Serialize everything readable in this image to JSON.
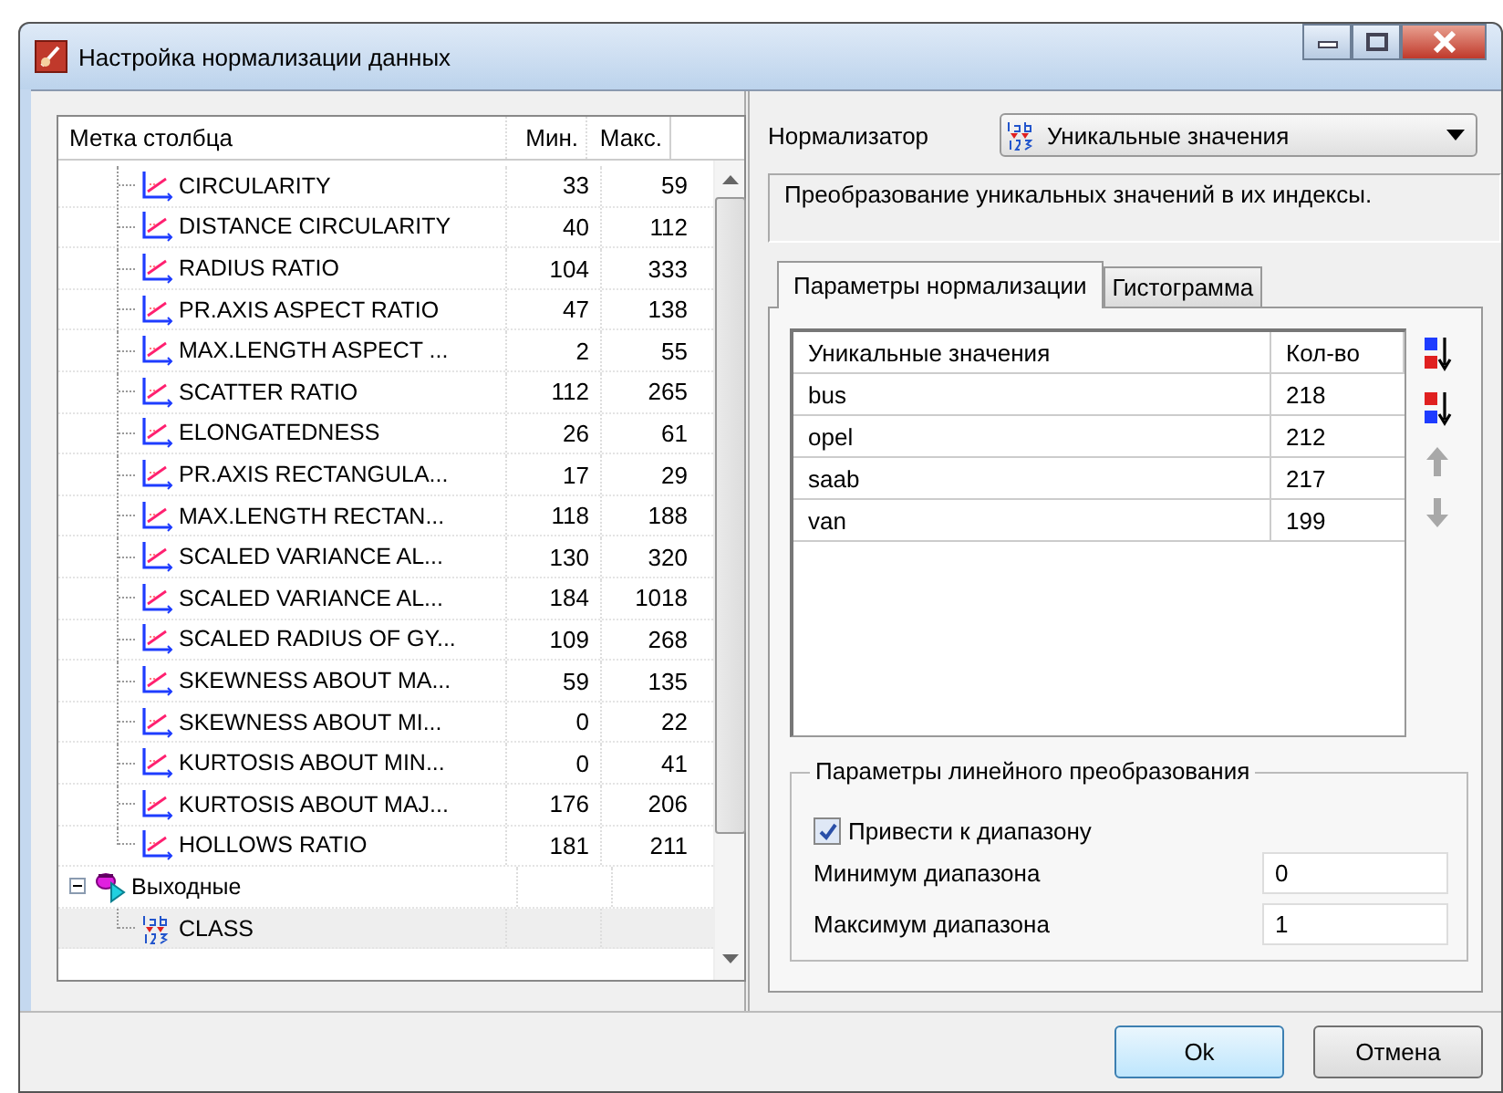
{
  "window": {
    "title": "Настройка нормализации данных"
  },
  "tree": {
    "columns": [
      "Метка столбца",
      "Мин.",
      "Макс."
    ],
    "fields": [
      {
        "label": "CIRCULARITY",
        "min": "33",
        "max": "59",
        "kind": "numeric",
        "selected": false
      },
      {
        "label": "DISTANCE CIRCULARITY",
        "min": "40",
        "max": "112",
        "kind": "numeric",
        "selected": false
      },
      {
        "label": "RADIUS RATIO",
        "min": "104",
        "max": "333",
        "kind": "numeric",
        "selected": false
      },
      {
        "label": "PR.AXIS ASPECT RATIO",
        "min": "47",
        "max": "138",
        "kind": "numeric",
        "selected": false
      },
      {
        "label": "MAX.LENGTH ASPECT ...",
        "min": "2",
        "max": "55",
        "kind": "numeric",
        "selected": false
      },
      {
        "label": "SCATTER RATIO",
        "min": "112",
        "max": "265",
        "kind": "numeric",
        "selected": false
      },
      {
        "label": "ELONGATEDNESS",
        "min": "26",
        "max": "61",
        "kind": "numeric",
        "selected": false
      },
      {
        "label": "PR.AXIS RECTANGULA...",
        "min": "17",
        "max": "29",
        "kind": "numeric",
        "selected": false
      },
      {
        "label": "MAX.LENGTH RECTAN...",
        "min": "118",
        "max": "188",
        "kind": "numeric",
        "selected": false
      },
      {
        "label": "SCALED VARIANCE AL...",
        "min": "130",
        "max": "320",
        "kind": "numeric",
        "selected": false
      },
      {
        "label": "SCALED VARIANCE AL...",
        "min": "184",
        "max": "1018",
        "kind": "numeric",
        "selected": false
      },
      {
        "label": "SCALED RADIUS OF GY...",
        "min": "109",
        "max": "268",
        "kind": "numeric",
        "selected": false
      },
      {
        "label": "SKEWNESS ABOUT MA...",
        "min": "59",
        "max": "135",
        "kind": "numeric",
        "selected": false
      },
      {
        "label": "SKEWNESS ABOUT MI...",
        "min": "0",
        "max": "22",
        "kind": "numeric",
        "selected": false
      },
      {
        "label": "KURTOSIS ABOUT MIN...",
        "min": "0",
        "max": "41",
        "kind": "numeric",
        "selected": false
      },
      {
        "label": "KURTOSIS ABOUT MAJ...",
        "min": "176",
        "max": "206",
        "kind": "numeric",
        "selected": false
      },
      {
        "label": "HOLLOWS RATIO",
        "min": "181",
        "max": "211",
        "kind": "numeric",
        "selected": false
      }
    ],
    "outputs": {
      "label": "Выходные",
      "expanded": true,
      "children": [
        {
          "label": "CLASS",
          "kind": "text",
          "selected": true
        }
      ]
    }
  },
  "normalizer": {
    "label": "Нормализатор",
    "value": "Уникальные значения",
    "description": "Преобразование уникальных значений в их индексы."
  },
  "tabs": [
    {
      "label": "Параметры нормализации",
      "selected": true
    },
    {
      "label": "Гистограмма",
      "selected": false
    }
  ],
  "values_table": {
    "columns": [
      "Уникальные значения",
      "Кол-во"
    ],
    "rows": [
      {
        "value": "bus",
        "count": "218"
      },
      {
        "value": "opel",
        "count": "212"
      },
      {
        "value": "saab",
        "count": "217"
      },
      {
        "value": "van",
        "count": "199"
      }
    ]
  },
  "linear": {
    "title": "Параметры линейного преобразования",
    "checkbox": {
      "label": "Привести к диапазону",
      "checked": true
    },
    "fields": [
      {
        "label": "Минимум диапазона",
        "value": "0"
      },
      {
        "label": "Максимум диапазона",
        "value": "1"
      }
    ]
  },
  "buttons": [
    "Ok",
    "Отмена"
  ]
}
